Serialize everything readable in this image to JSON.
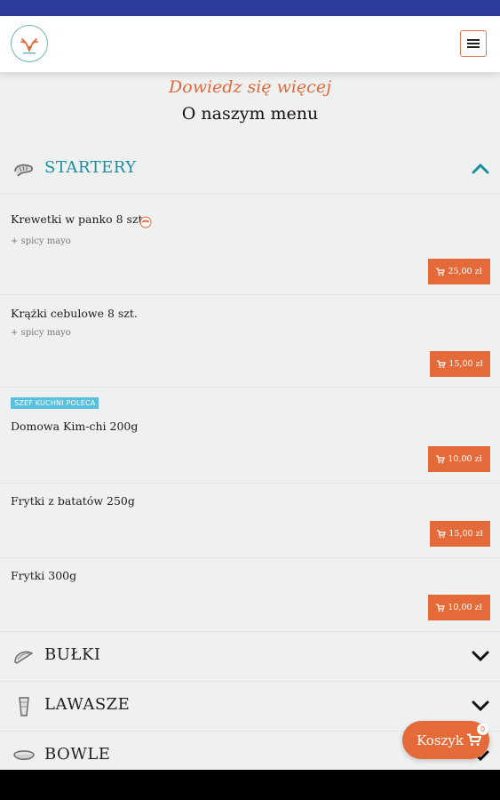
{
  "header": {
    "logo_icon": "deer-antlers-logo",
    "menu_icon": "hamburger-icon"
  },
  "section": {
    "kicker": "Dowiedz się więcej",
    "title": "O naszym menu"
  },
  "categories": [
    {
      "name": "STARTERY",
      "icon": "shrimp-icon",
      "expanded": true,
      "color": "#1a8fa0"
    },
    {
      "name": "BUŁKI",
      "icon": "taco-icon",
      "expanded": false
    },
    {
      "name": "LAWASZE",
      "icon": "wrap-icon",
      "expanded": false
    },
    {
      "name": "BOWLE",
      "icon": "bowl-icon",
      "expanded": false
    }
  ],
  "items": [
    {
      "name": "Krewetki w panko 8 szt.",
      "desc": "+ spicy mayo",
      "price": "25,00 zł",
      "spicy": true
    },
    {
      "name": "Krążki cebulowe 8 szt.",
      "desc": "+ spicy mayo",
      "price": "15,00 zł"
    },
    {
      "name": "Domowa Kim-chi 200g",
      "badge": "SZEF KUCHNI POLECA",
      "price": "10,00 zł"
    },
    {
      "name": "Frytki z batatów 250g",
      "price": "15,00 zł"
    },
    {
      "name": "Frytki 300g",
      "price": "10,00 zł"
    }
  ],
  "cart": {
    "label": "Koszyk",
    "count": "0"
  },
  "colors": {
    "accent": "#e56a3a",
    "teal": "#1a8fa0",
    "statusbar": "#2e3a9c",
    "badge": "#5bc0de"
  }
}
